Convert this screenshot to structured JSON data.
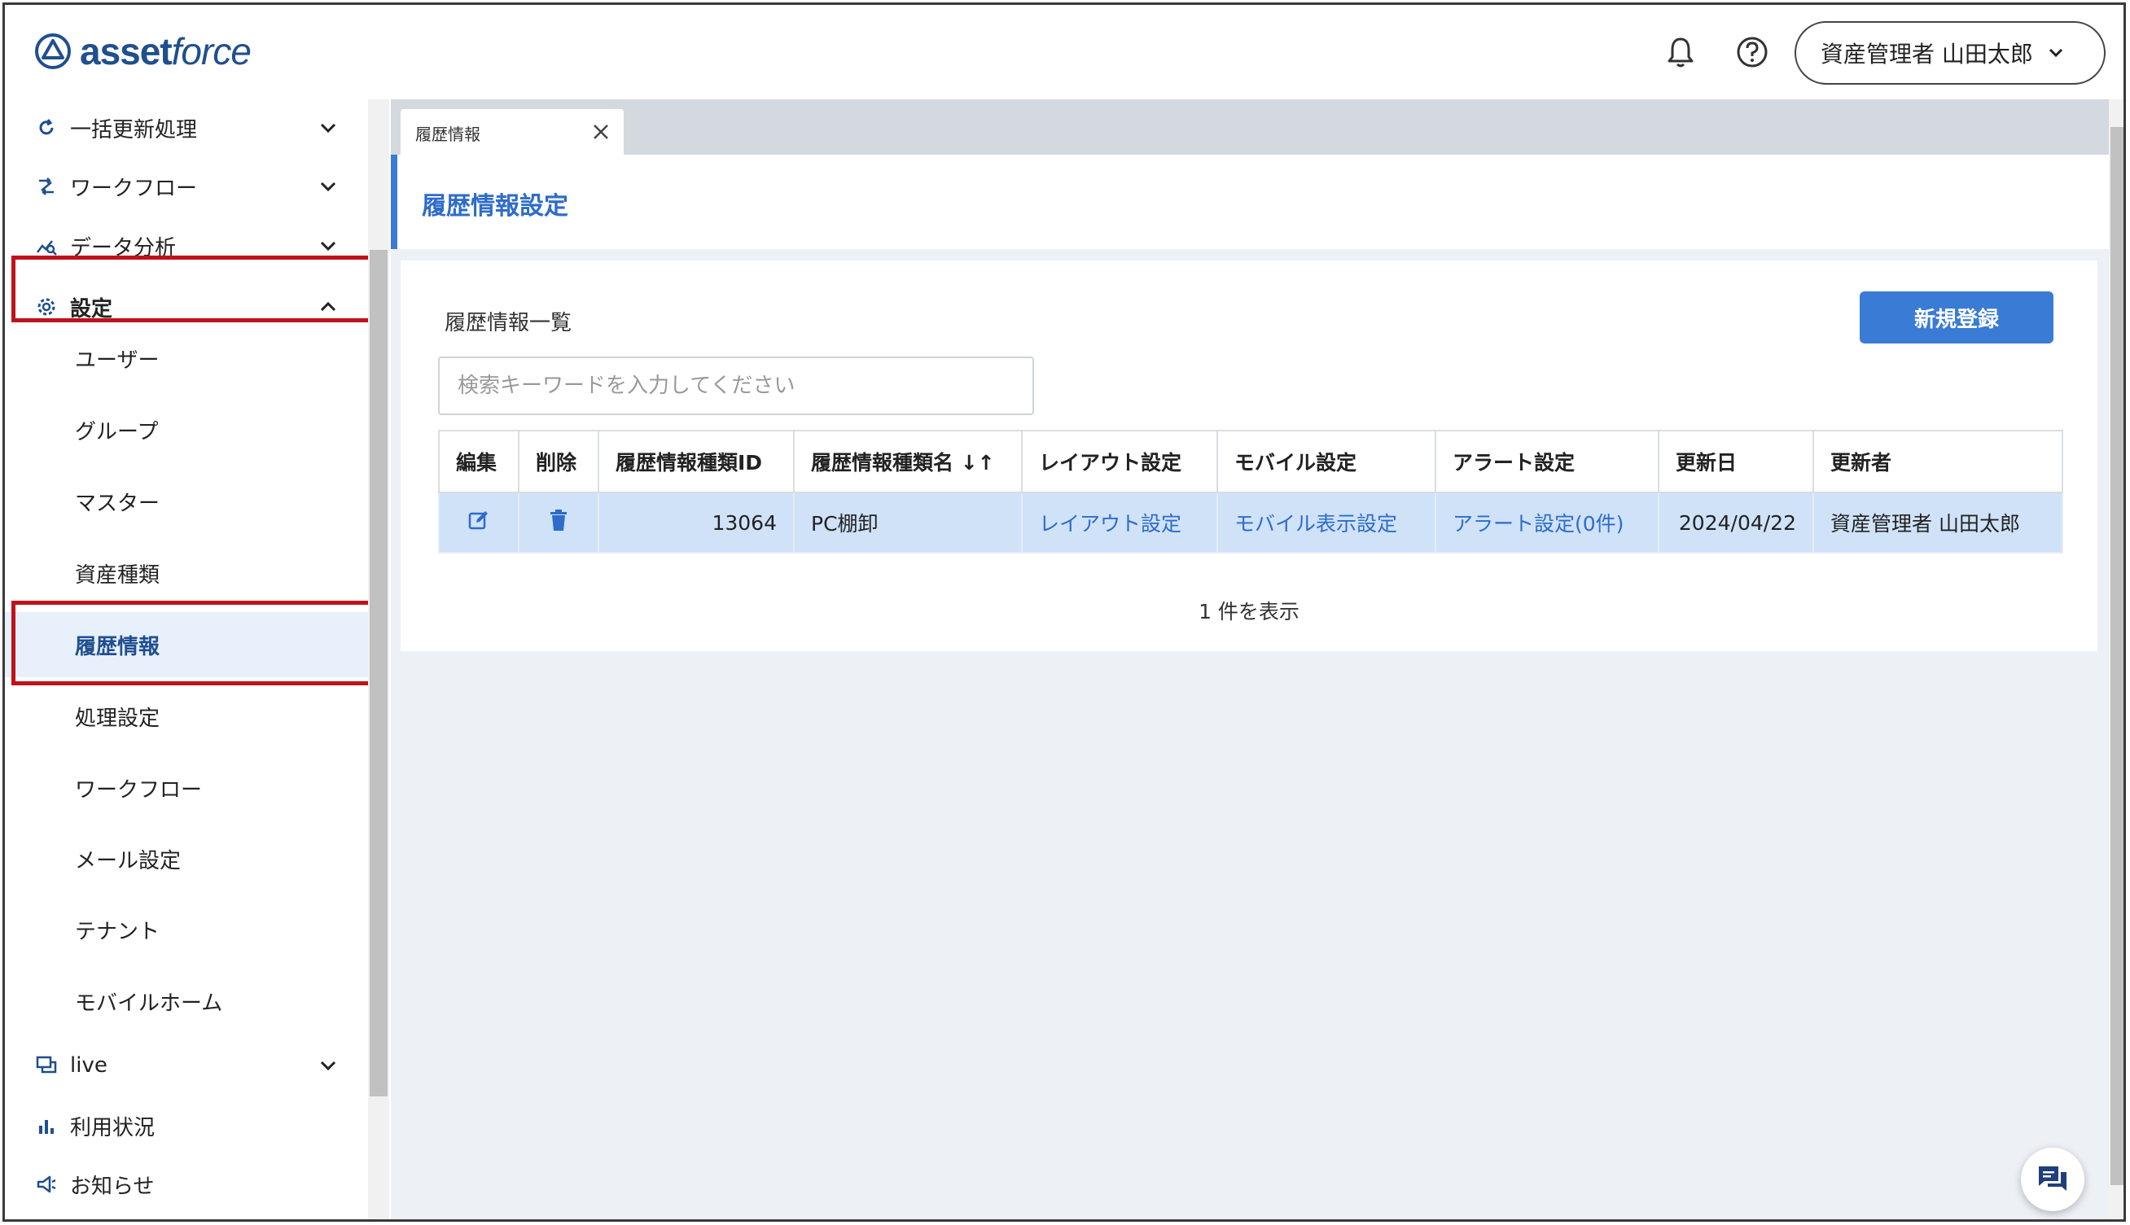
{
  "header": {
    "logo_text_bold": "asset",
    "logo_text_light": "force",
    "user_label": "資産管理者 山田太郎"
  },
  "sidebar": {
    "items": [
      {
        "label": "一括更新処理",
        "icon": "refresh-icon"
      },
      {
        "label": "ワークフロー",
        "icon": "workflow-icon"
      },
      {
        "label": "データ分析",
        "icon": "analytics-icon"
      },
      {
        "label": "設定",
        "icon": "gear-icon"
      }
    ],
    "settings_sub": [
      {
        "label": "ユーザー"
      },
      {
        "label": "グループ"
      },
      {
        "label": "マスター"
      },
      {
        "label": "資産種類"
      },
      {
        "label": "履歴情報"
      },
      {
        "label": "処理設定"
      },
      {
        "label": "ワークフロー"
      },
      {
        "label": "メール設定"
      },
      {
        "label": "テナント"
      },
      {
        "label": "モバイルホーム"
      }
    ],
    "bottom_items": [
      {
        "label": "live",
        "icon": "chat-icon"
      },
      {
        "label": "利用状況",
        "icon": "bar-chart-icon"
      },
      {
        "label": "お知らせ",
        "icon": "megaphone-icon"
      }
    ]
  },
  "tab": {
    "label": "履歴情報"
  },
  "page": {
    "title": "履歴情報設定",
    "list_title": "履歴情報一覧",
    "new_button": "新規登録",
    "search_placeholder": "検索キーワードを入力してください",
    "count_text": "1 件を表示"
  },
  "table": {
    "headers": [
      "編集",
      "削除",
      "履歴情報種類ID",
      "履歴情報種類名",
      "レイアウト設定",
      "モバイル設定",
      "アラート設定",
      "更新日",
      "更新者"
    ],
    "rows": [
      {
        "id": "13064",
        "name": "PC棚卸",
        "layout": "レイアウト設定",
        "mobile": "モバイル表示設定",
        "alert": "アラート設定(0件)",
        "updated": "2024/04/22",
        "updater": "資産管理者 山田太郎"
      }
    ]
  },
  "colors": {
    "accent": "#3a7bd5",
    "highlight_box": "#c0121a",
    "row_selected": "#cfe2f8"
  }
}
